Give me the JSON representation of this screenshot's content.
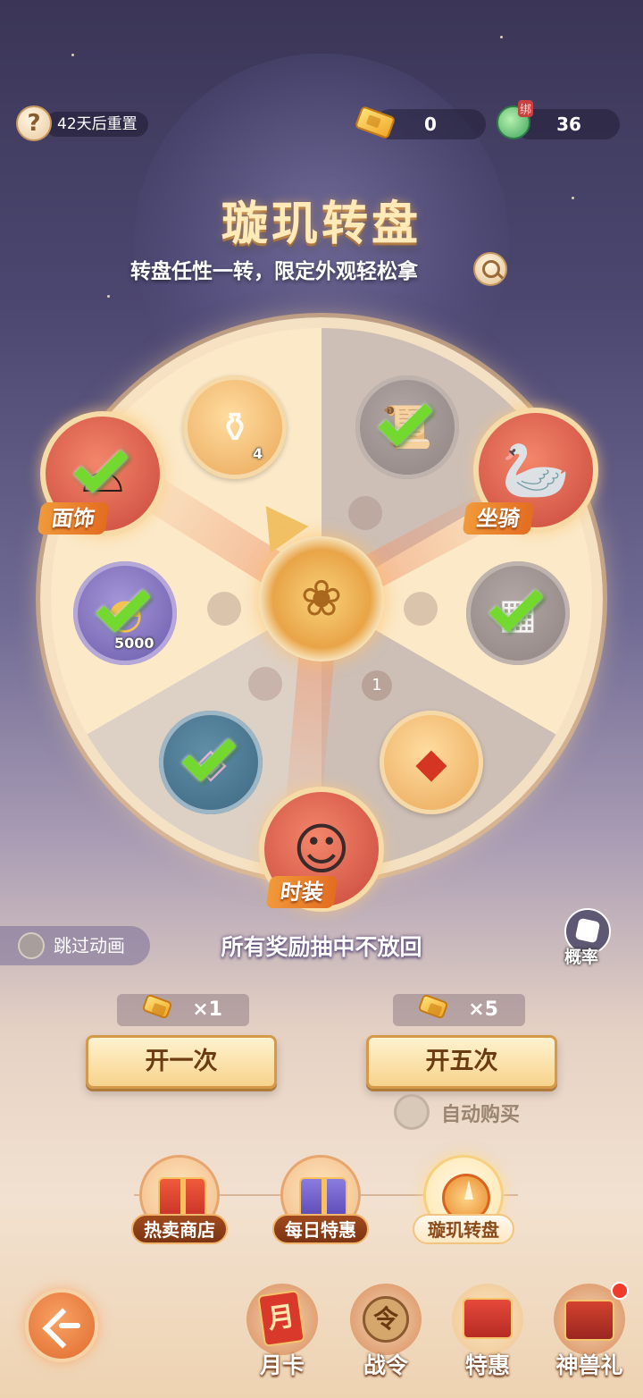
{
  "topbar": {
    "help_glyph": "?",
    "reset_text": "42天后重置",
    "ticket_count": "0",
    "bind_tag": "绑",
    "jade_count": "36"
  },
  "header": {
    "title": "璇玑转盘",
    "subtitle": "转盘任性一转，限定外观轻松拿"
  },
  "wheel": {
    "items": [
      {
        "name": "flask",
        "count": "4",
        "claimed": false
      },
      {
        "name": "scroll",
        "claimed": true
      },
      {
        "name": "gold-ingot",
        "count": "5000",
        "claimed": true
      },
      {
        "name": "bundle",
        "claimed": true
      },
      {
        "name": "gem-box",
        "claimed": true
      },
      {
        "name": "red-crystal",
        "claimed": false
      }
    ],
    "big_prizes": [
      {
        "label": "面饰",
        "claimed": true
      },
      {
        "label": "坐骑",
        "claimed": false
      },
      {
        "label": "时装",
        "claimed": false
      }
    ],
    "number_marker": "1"
  },
  "controls": {
    "skip_label": "跳过动画",
    "rule_text": "所有奖励抽中不放回",
    "probability_label": "概率",
    "single_cost": "×1",
    "five_cost": "×5",
    "single_button": "开一次",
    "five_button": "开五次",
    "auto_buy_label": "自动购买"
  },
  "tabs": [
    {
      "label": "热卖商店",
      "active": false
    },
    {
      "label": "每日特惠",
      "active": false
    },
    {
      "label": "璇玑转盘",
      "active": true
    }
  ],
  "bottom_nav": [
    {
      "label": "月卡",
      "glyph": "月"
    },
    {
      "label": "战令",
      "glyph": "令"
    },
    {
      "label": "特惠",
      "glyph": ""
    },
    {
      "label": "神兽礼",
      "glyph": ""
    }
  ]
}
